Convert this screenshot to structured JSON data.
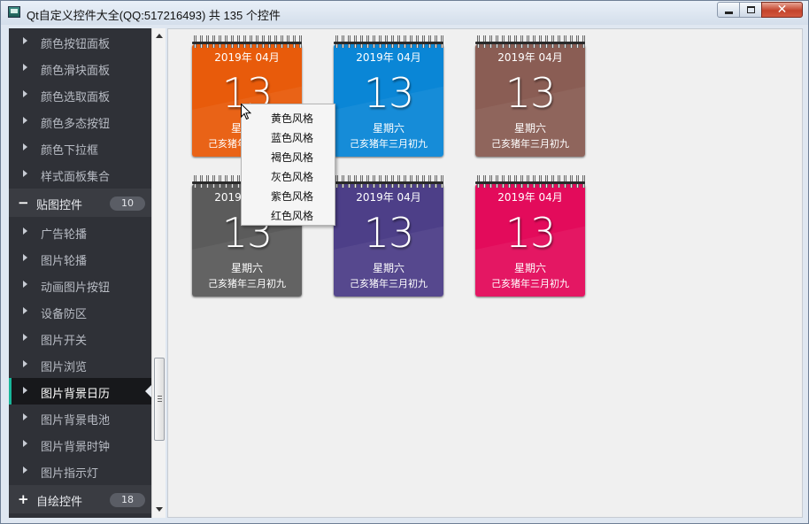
{
  "window": {
    "title": "Qt自定义控件大全(QQ:517216493) 共 135 个控件",
    "close_glyph": "✕"
  },
  "sidebar": {
    "items_top": [
      {
        "label": "颜色按钮面板"
      },
      {
        "label": "颜色滑块面板"
      },
      {
        "label": "颜色选取面板"
      },
      {
        "label": "颜色多态按钮"
      },
      {
        "label": "颜色下拉框"
      },
      {
        "label": "样式面板集合"
      }
    ],
    "group_expanded": {
      "sign": "−",
      "label": "贴图控件",
      "count": "10"
    },
    "items_group": [
      {
        "label": "广告轮播"
      },
      {
        "label": "图片轮播"
      },
      {
        "label": "动画图片按钮"
      },
      {
        "label": "设备防区"
      },
      {
        "label": "图片开关"
      },
      {
        "label": "图片浏览"
      },
      {
        "label": "图片背景日历",
        "selected": true
      },
      {
        "label": "图片背景电池"
      },
      {
        "label": "图片背景时钟"
      },
      {
        "label": "图片指示灯"
      }
    ],
    "group_collapsed": {
      "sign": "+",
      "label": "自绘控件",
      "count": "18"
    }
  },
  "calendars": [
    {
      "style": "orange",
      "color": "#e85b0b",
      "year_month": "2019年 04月",
      "day": "13",
      "weekday": "星期六",
      "lunar": "己亥猪年三月初九"
    },
    {
      "style": "blue",
      "color": "#0a86d6",
      "year_month": "2019年 04月",
      "day": "13",
      "weekday": "星期六",
      "lunar": "己亥猪年三月初九"
    },
    {
      "style": "brown",
      "color": "#8a5d54",
      "year_month": "2019年 04月",
      "day": "13",
      "weekday": "星期六",
      "lunar": "己亥猪年三月初九"
    },
    {
      "style": "gray",
      "color": "#5b5b5b",
      "year_month": "2019年 04月",
      "day": "13",
      "weekday": "星期六",
      "lunar": "己亥猪年三月初九"
    },
    {
      "style": "purple",
      "color": "#4d3f88",
      "year_month": "2019年 04月",
      "day": "13",
      "weekday": "星期六",
      "lunar": "己亥猪年三月初九"
    },
    {
      "style": "red",
      "color": "#e30b5b",
      "year_month": "2019年 04月",
      "day": "13",
      "weekday": "星期六",
      "lunar": "己亥猪年三月初九"
    }
  ],
  "context_menu": {
    "items": [
      "黄色风格",
      "蓝色风格",
      "褐色风格",
      "灰色风格",
      "紫色风格",
      "红色风格"
    ]
  },
  "colors": {
    "sidebar_bg": "#2f3137",
    "selected_accent": "#18b69a",
    "content_bg": "#f0f0f0"
  }
}
